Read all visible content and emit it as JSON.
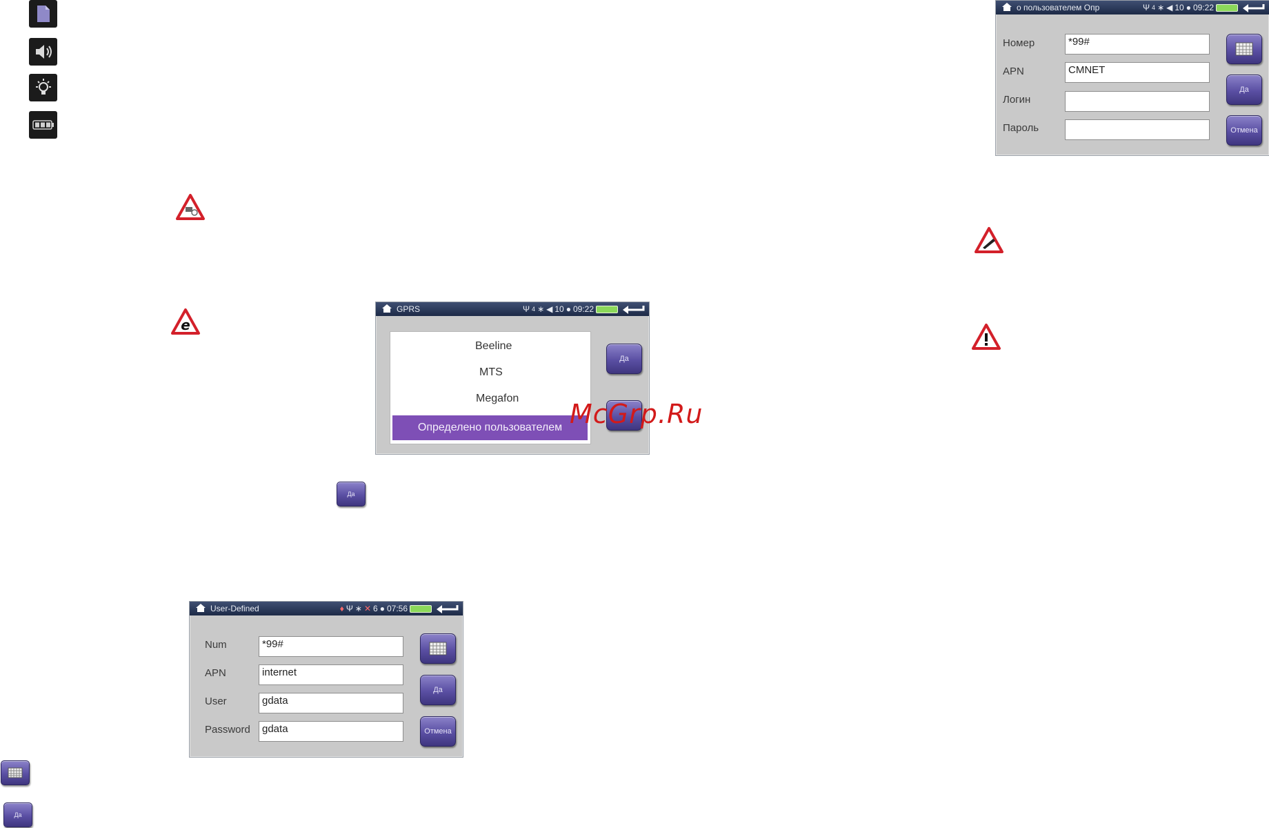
{
  "watermark": "McGrp.Ru",
  "left_icons": [
    "document-icon",
    "speaker-icon",
    "brightness-icon",
    "battery-icon"
  ],
  "gprs_screen": {
    "title": "GPRS",
    "signal": "4",
    "volume": "10",
    "time": "09:22",
    "items": [
      "Beeline",
      "MTS",
      "Megafon"
    ],
    "selected_item": "Определено пользователем",
    "ok_label": "Да"
  },
  "standalone_ok_label": "Да",
  "user_defined_screen": {
    "title": "User-Defined",
    "volume": "6",
    "time": "07:56",
    "fields": [
      {
        "label": "Num",
        "value": "*99#"
      },
      {
        "label": "APN",
        "value": "internet"
      },
      {
        "label": "User",
        "value": "gdata"
      },
      {
        "label": "Password",
        "value": "gdata"
      }
    ],
    "ok_label": "Да",
    "cancel_label": "Отмена"
  },
  "bottom_ok_label": "Да",
  "ru_screen": {
    "title": "о пользователем   Опр",
    "signal": "4",
    "volume": "10",
    "time": "09:22",
    "fields": [
      {
        "label": "Номер",
        "value": "*99#"
      },
      {
        "label": "APN",
        "value": "CMNET"
      },
      {
        "label": "Логин",
        "value": ""
      },
      {
        "label": "Пароль",
        "value": ""
      }
    ],
    "ok_label": "Да",
    "cancel_label": "Отмена"
  },
  "colors": {
    "accent_purple": "#7e4fb6",
    "warning_red": "#d3202a",
    "status_bar": "#2a3858"
  }
}
